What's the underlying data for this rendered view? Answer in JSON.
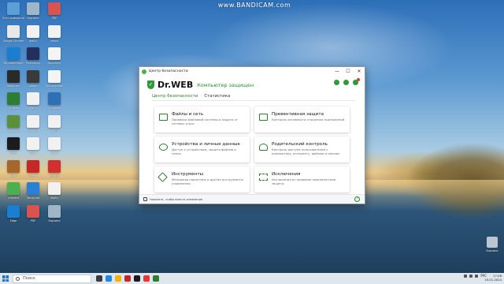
{
  "watermark": "www.BANDICAM.com",
  "desktop_icons": [
    {
      "label": "Этот компьютер",
      "color": "#5aa0d6"
    },
    {
      "label": "Корзина",
      "color": "#9fb6c9"
    },
    {
      "label": "PDF",
      "color": "#d9534f"
    },
    {
      "label": "Google Chrome",
      "color": "#e8e8e8"
    },
    {
      "label": "файл",
      "color": "#f1f1f1"
    },
    {
      "label": "папка",
      "color": "#f1f1f1"
    },
    {
      "label": "Microsoft Edge",
      "color": "#1a7fd0"
    },
    {
      "label": "Photoshop",
      "color": "#23305e"
    },
    {
      "label": "Документ",
      "color": "#f4f4f4"
    },
    {
      "label": "Bandicam",
      "color": "#2a2a2a"
    },
    {
      "label": "Adobe",
      "color": "#3a3a3a"
    },
    {
      "label": "Приложение",
      "color": "#f4f4f4"
    },
    {
      "label": "Dr.Web",
      "color": "#2e7d32"
    },
    {
      "label": "Файл",
      "color": "#f1f1f1"
    },
    {
      "label": "Windows",
      "color": "#2f6fb5"
    },
    {
      "label": "Minecraft",
      "color": "#5b8f3a"
    },
    {
      "label": "Image",
      "color": "#f1f1f1"
    },
    {
      "label": "Файл",
      "color": "#f1f1f1"
    },
    {
      "label": "Video",
      "color": "#1c1c1c"
    },
    {
      "label": "Paint",
      "color": "#f1f1f1"
    },
    {
      "label": "Word",
      "color": "#f1f1f1"
    },
    {
      "label": "Rust",
      "color": "#a5672b"
    },
    {
      "label": "Opera",
      "color": "#c62828"
    },
    {
      "label": "Record",
      "color": "#d32f2f"
    },
    {
      "label": "uTorrent",
      "color": "#4caf50"
    },
    {
      "label": "Загрузки",
      "color": "#2b7fd6"
    },
    {
      "label": "Файл",
      "color": "#f1f1f1"
    },
    {
      "label": "Edge",
      "color": "#1a7fd0"
    },
    {
      "label": "PDF",
      "color": "#d9534f"
    },
    {
      "label": "Корзина",
      "color": "#9fb6c9"
    }
  ],
  "window": {
    "title": "Центр безопасности",
    "minimize": "—",
    "maximize": "☐",
    "close": "✕",
    "brand": "Dr.WEB",
    "status": "Компьютер защищен",
    "tabs": [
      {
        "label": "Центр безопасности",
        "active": true
      },
      {
        "label": "Статистика",
        "active": false
      }
    ],
    "cards": [
      {
        "title": "Файлы и сеть",
        "desc": "Проверка файловой системы и защита от сетевых угроз"
      },
      {
        "title": "Превентивная защита",
        "desc": "Контроль активности сторонних приложений"
      },
      {
        "title": "Устройства и личные данные",
        "desc": "Доступ к устройствам, защита файлов и папок"
      },
      {
        "title": "Родительский контроль",
        "desc": "Контроль доступа пользователей к компьютеру, интернету, файлам и папкам"
      },
      {
        "title": "Инструменты",
        "desc": "Менеджер карантина и другие инструменты управления"
      },
      {
        "title": "Исключения",
        "desc": "Исключения из проверки компонентами защиты"
      }
    ],
    "footer_text": "Нажмите, чтобы внести изменения",
    "help": "?",
    "accent": "#2e7d32"
  },
  "desktop_bottom_right": "Корзина",
  "taskbar": {
    "search_placeholder": "Поиск",
    "tray_lang": "РУС",
    "time": "17:48",
    "date": "19.01.2024"
  }
}
